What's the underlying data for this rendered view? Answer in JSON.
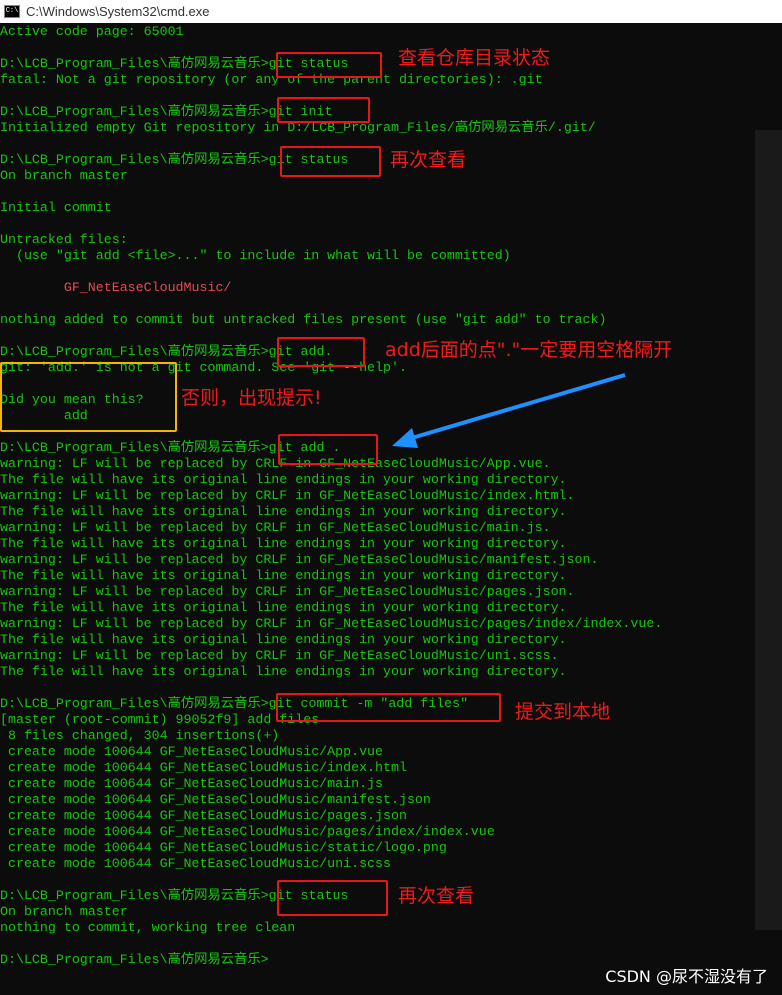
{
  "window": {
    "title": "C:\\Windows\\System32\\cmd.exe",
    "icon": "cmd-icon"
  },
  "terminal": {
    "lines": [
      {
        "text": "Active code page: 65001"
      },
      {
        "text": ""
      },
      {
        "text": "D:\\LCB_Program_Files\\高仿网易云音乐>git status"
      },
      {
        "text": "fatal: Not a git repository (or any of the parent directories): .git"
      },
      {
        "text": ""
      },
      {
        "text": "D:\\LCB_Program_Files\\高仿网易云音乐>git init"
      },
      {
        "text": "Initialized empty Git repository in D:/LCB_Program_Files/高仿网易云音乐/.git/"
      },
      {
        "text": ""
      },
      {
        "text": "D:\\LCB_Program_Files\\高仿网易云音乐>git status"
      },
      {
        "text": "On branch master"
      },
      {
        "text": ""
      },
      {
        "text": "Initial commit"
      },
      {
        "text": ""
      },
      {
        "text": "Untracked files:"
      },
      {
        "text": "  (use \"git add <file>...\" to include in what will be committed)"
      },
      {
        "text": ""
      },
      {
        "text": "        GF_NetEaseCloudMusic/",
        "color": "red"
      },
      {
        "text": ""
      },
      {
        "text": "nothing added to commit but untracked files present (use \"git add\" to track)"
      },
      {
        "text": ""
      },
      {
        "text": "D:\\LCB_Program_Files\\高仿网易云音乐>git add."
      },
      {
        "text": "git: 'add.' is not a git command. See 'git --help'."
      },
      {
        "text": ""
      },
      {
        "text": "Did you mean this?"
      },
      {
        "text": "        add"
      },
      {
        "text": ""
      },
      {
        "text": "D:\\LCB_Program_Files\\高仿网易云音乐>git add ."
      },
      {
        "text": "warning: LF will be replaced by CRLF in GF_NetEaseCloudMusic/App.vue."
      },
      {
        "text": "The file will have its original line endings in your working directory."
      },
      {
        "text": "warning: LF will be replaced by CRLF in GF_NetEaseCloudMusic/index.html."
      },
      {
        "text": "The file will have its original line endings in your working directory."
      },
      {
        "text": "warning: LF will be replaced by CRLF in GF_NetEaseCloudMusic/main.js."
      },
      {
        "text": "The file will have its original line endings in your working directory."
      },
      {
        "text": "warning: LF will be replaced by CRLF in GF_NetEaseCloudMusic/manifest.json."
      },
      {
        "text": "The file will have its original line endings in your working directory."
      },
      {
        "text": "warning: LF will be replaced by CRLF in GF_NetEaseCloudMusic/pages.json."
      },
      {
        "text": "The file will have its original line endings in your working directory."
      },
      {
        "text": "warning: LF will be replaced by CRLF in GF_NetEaseCloudMusic/pages/index/index.vue."
      },
      {
        "text": "The file will have its original line endings in your working directory."
      },
      {
        "text": "warning: LF will be replaced by CRLF in GF_NetEaseCloudMusic/uni.scss."
      },
      {
        "text": "The file will have its original line endings in your working directory."
      },
      {
        "text": ""
      },
      {
        "text": "D:\\LCB_Program_Files\\高仿网易云音乐>git commit -m \"add files\""
      },
      {
        "text": "[master (root-commit) 99052f9] add files"
      },
      {
        "text": " 8 files changed, 304 insertions(+)"
      },
      {
        "text": " create mode 100644 GF_NetEaseCloudMusic/App.vue"
      },
      {
        "text": " create mode 100644 GF_NetEaseCloudMusic/index.html"
      },
      {
        "text": " create mode 100644 GF_NetEaseCloudMusic/main.js"
      },
      {
        "text": " create mode 100644 GF_NetEaseCloudMusic/manifest.json"
      },
      {
        "text": " create mode 100644 GF_NetEaseCloudMusic/pages.json"
      },
      {
        "text": " create mode 100644 GF_NetEaseCloudMusic/pages/index/index.vue"
      },
      {
        "text": " create mode 100644 GF_NetEaseCloudMusic/static/logo.png"
      },
      {
        "text": " create mode 100644 GF_NetEaseCloudMusic/uni.scss"
      },
      {
        "text": ""
      },
      {
        "text": "D:\\LCB_Program_Files\\高仿网易云音乐>git status"
      },
      {
        "text": "On branch master"
      },
      {
        "text": "nothing to commit, working tree clean"
      },
      {
        "text": ""
      },
      {
        "text": "D:\\LCB_Program_Files\\高仿网易云音乐>"
      }
    ]
  },
  "annotations": {
    "status_check": "查看仓库目录状态",
    "check_again_1": "再次查看",
    "add_dot_note": "add后面的点\".\"一定要用空格隔开",
    "otherwise_note": "否则，出现提示!",
    "commit_note": "提交到本地",
    "check_again_2": "再次查看"
  },
  "colors": {
    "terminal_text": "#16c60c",
    "highlight_box": "#e8161b",
    "warning_box": "#f5b400",
    "arrow": "#1e90ff"
  },
  "watermark": "CSDN @尿不湿没有了"
}
